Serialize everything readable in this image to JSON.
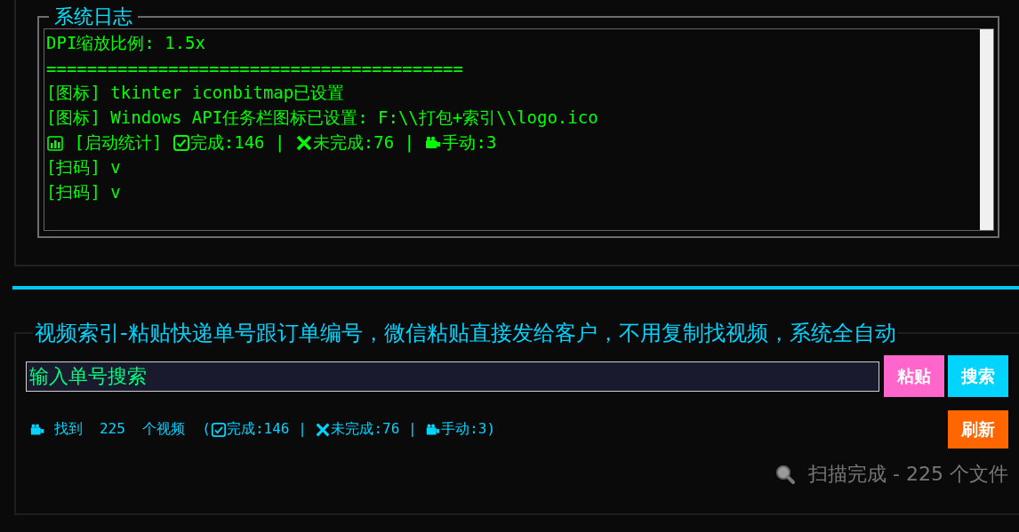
{
  "log_panel": {
    "title": "系统日志",
    "lines": [
      {
        "segments": [
          {
            "kind": "text",
            "text": "DPI缩放比例: 1.5x"
          }
        ]
      },
      {
        "segments": [
          {
            "kind": "text",
            "text": "========================================="
          }
        ]
      },
      {
        "segments": [
          {
            "kind": "text",
            "text": "[图标] tkinter iconbitmap已设置"
          }
        ]
      },
      {
        "segments": [
          {
            "kind": "text",
            "text": "[图标] Windows API任务栏图标已设置: F:\\\\打包+索引\\\\logo.ico"
          }
        ]
      },
      {
        "segments": [
          {
            "kind": "chart"
          },
          {
            "kind": "text",
            "text": " [启动统计] "
          },
          {
            "kind": "check"
          },
          {
            "kind": "text",
            "text": "完成:146 | "
          },
          {
            "kind": "cross"
          },
          {
            "kind": "text",
            "text": "未完成:76 | "
          },
          {
            "kind": "camera"
          },
          {
            "kind": "text",
            "text": "手动:3"
          }
        ]
      },
      {
        "segments": [
          {
            "kind": "text",
            "text": "[扫码] v"
          }
        ]
      },
      {
        "segments": [
          {
            "kind": "text",
            "text": "[扫码] v"
          }
        ]
      }
    ]
  },
  "search_panel": {
    "title": "视频索引-粘贴快递单号跟订单编号，微信粘贴直接发给客户，不用复制找视频，系统全自动",
    "search": {
      "placeholder": "输入单号搜索"
    },
    "buttons": [
      {
        "kind": "paste",
        "label": "粘贴"
      },
      {
        "kind": "search",
        "label": "搜索"
      }
    ],
    "stats": {
      "segments": [
        {
          "kind": "camera"
        },
        {
          "kind": "text",
          "text": " 找到  225  个视频  ("
        },
        {
          "kind": "check"
        },
        {
          "kind": "text",
          "text": "完成:146 | "
        },
        {
          "kind": "cross"
        },
        {
          "kind": "text",
          "text": "未完成:76 | "
        },
        {
          "kind": "camera"
        },
        {
          "kind": "text",
          "text": "手动:3)"
        }
      ]
    },
    "refresh_button": "刷新",
    "status": "扫描完成 - 225 个文件"
  }
}
